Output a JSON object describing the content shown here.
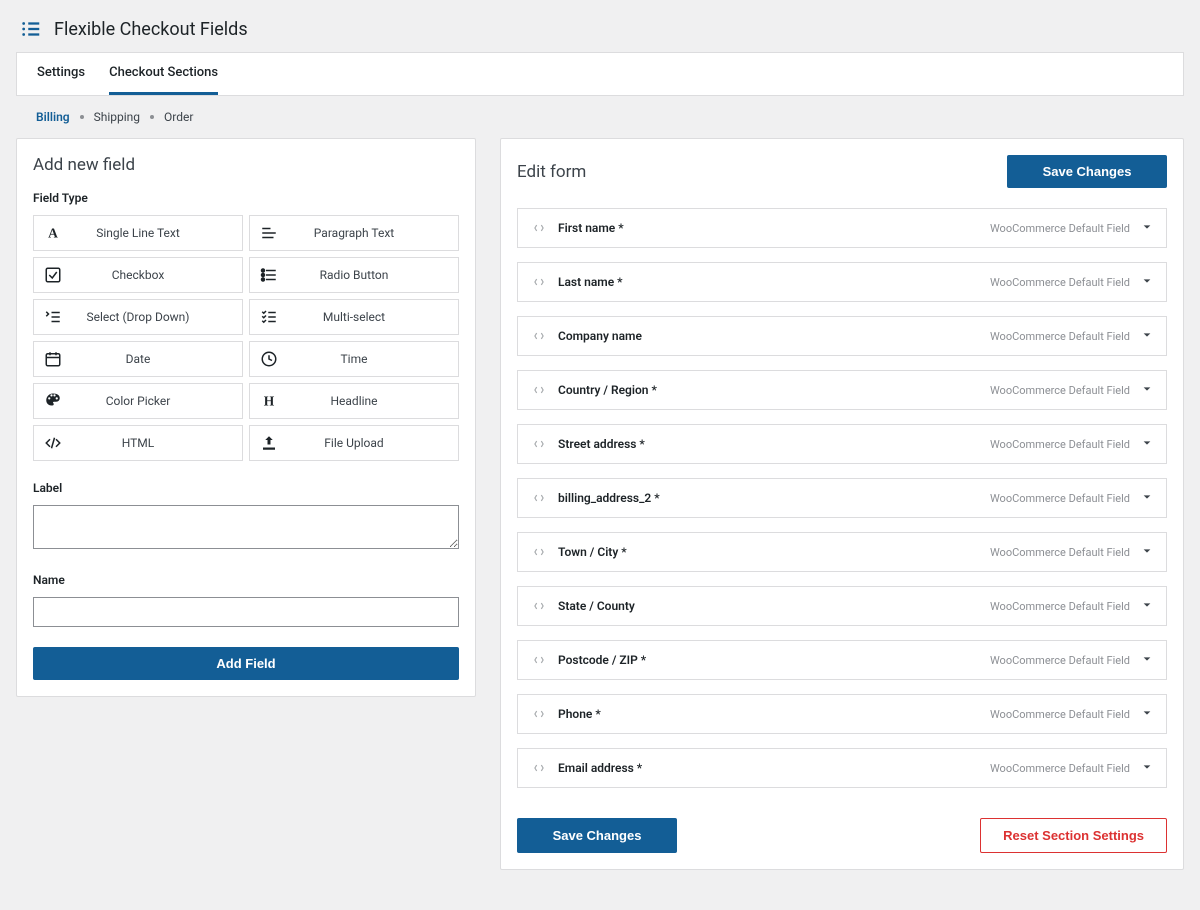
{
  "header": {
    "title": "Flexible Checkout Fields"
  },
  "tabs": [
    {
      "label": "Settings",
      "active": false
    },
    {
      "label": "Checkout Sections",
      "active": true
    }
  ],
  "breadcrumb": [
    {
      "label": "Billing",
      "active": true
    },
    {
      "label": "Shipping",
      "active": false
    },
    {
      "label": "Order",
      "active": false
    }
  ],
  "left_panel": {
    "title": "Add new field",
    "field_type_label": "Field Type",
    "field_types": [
      {
        "icon": "text-icon",
        "label": "Single Line Text"
      },
      {
        "icon": "paragraph-icon",
        "label": "Paragraph Text"
      },
      {
        "icon": "checkbox-icon",
        "label": "Checkbox"
      },
      {
        "icon": "radio-icon",
        "label": "Radio Button"
      },
      {
        "icon": "select-icon",
        "label": "Select (Drop Down)"
      },
      {
        "icon": "multiselect-icon",
        "label": "Multi-select"
      },
      {
        "icon": "date-icon",
        "label": "Date"
      },
      {
        "icon": "time-icon",
        "label": "Time"
      },
      {
        "icon": "color-icon",
        "label": "Color Picker"
      },
      {
        "icon": "headline-icon",
        "label": "Headline"
      },
      {
        "icon": "html-icon",
        "label": "HTML"
      },
      {
        "icon": "upload-icon",
        "label": "File Upload"
      }
    ],
    "label_label": "Label",
    "label_value": "",
    "name_label": "Name",
    "name_value": "",
    "add_button": "Add Field"
  },
  "right_panel": {
    "title": "Edit form",
    "save_button": "Save Changes",
    "reset_button": "Reset Section Settings",
    "default_badge": "WooCommerce Default Field",
    "fields": [
      {
        "label": "First name *"
      },
      {
        "label": "Last name *"
      },
      {
        "label": "Company name"
      },
      {
        "label": "Country / Region *"
      },
      {
        "label": "Street address *"
      },
      {
        "label": "billing_address_2 *"
      },
      {
        "label": "Town / City *"
      },
      {
        "label": "State / County"
      },
      {
        "label": "Postcode / ZIP *"
      },
      {
        "label": "Phone *"
      },
      {
        "label": "Email address *"
      }
    ]
  }
}
